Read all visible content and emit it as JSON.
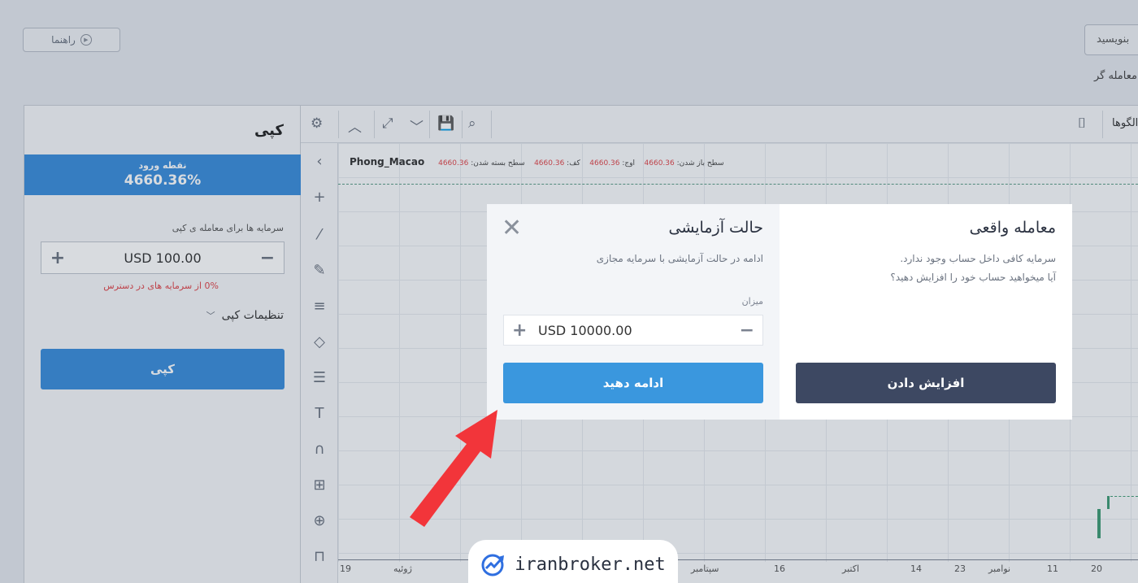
{
  "header": {
    "guide_label": "راهنما",
    "write_placeholder": "بنویسید",
    "trader_label": "معامله گر"
  },
  "left_panel": {
    "title": "کپی",
    "entry_label": "نقطه ورود",
    "entry_value": "4660.36%",
    "capital_label": "سرمایه ها برای معامله ی کپی",
    "amount": "USD 100.00",
    "available": "0% از سرمایه های در دسترس",
    "settings_label": "تنظیمات کپی",
    "copy_button": "کپی"
  },
  "chart": {
    "patterns_label": "الگوها",
    "symbol": "Phong_Macao",
    "ohlc": {
      "open_label": "سطح باز شدن:",
      "open_value": "4660.36",
      "high_label": "اوج:",
      "high_value": "4660.36",
      "low_label": "کف:",
      "low_value": "4660.36",
      "close_label": "سطح بسته شدن:",
      "close_value": "4660.36"
    },
    "x_labels": [
      "19",
      "ژوئیه",
      "سپتامبر",
      "16",
      "اکتبر",
      "14",
      "23",
      "نوامبر",
      "11",
      "20"
    ]
  },
  "modal": {
    "demo": {
      "title": "حالت آزمایشی",
      "desc": "ادامه در حالت آزمایشی با سرمایه مجازی",
      "amount_label": "میزان",
      "amount": "USD 10000.00",
      "button": "ادامه دهید"
    },
    "real": {
      "title": "معامله واقعی",
      "desc1": "سرمایه کافی داخل حساب وجود ندارد.",
      "desc2": "آیا میخواهید حساب خود را افزایش دهید؟",
      "button": "افزایش دادن"
    }
  },
  "watermark": "iranbroker.net",
  "colors": {
    "accent": "#3a8ddb",
    "dark_button": "#3d4862",
    "arrow": "#f2353a",
    "candle": "#3f9c75"
  }
}
